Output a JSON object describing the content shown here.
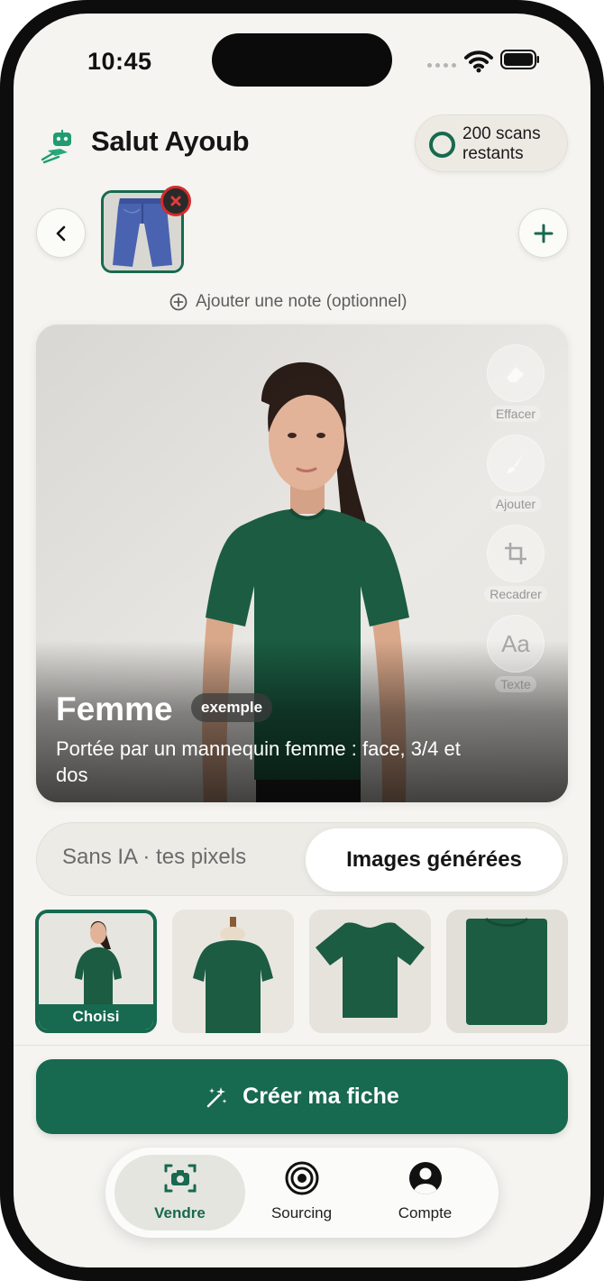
{
  "status_bar": {
    "time": "10:45"
  },
  "header": {
    "greeting": "Salut Ayoub",
    "scans_line1": "200 scans",
    "scans_line2": "restants"
  },
  "uploads": {
    "note_label": "Ajouter une note (optionnel)"
  },
  "hero": {
    "title": "Femme",
    "badge": "exemple",
    "description": "Portée par un mannequin femme : face, 3/4 et dos",
    "tools": [
      "Effacer",
      "Ajouter",
      "Recadrer",
      "Texte"
    ],
    "text_tool_glyph": "Aa"
  },
  "mode_toggle": {
    "options": [
      "Sans IA · tes pixels",
      "Images générées"
    ],
    "selected": "Images générées"
  },
  "variants": {
    "selected_label": "Choisi"
  },
  "cta": {
    "label": "Créer ma fiche"
  },
  "tabbar": {
    "tabs": [
      {
        "label": "Vendre",
        "icon": "camera-icon",
        "active": true
      },
      {
        "label": "Sourcing",
        "icon": "target-icon",
        "active": false
      },
      {
        "label": "Compte",
        "icon": "account-icon",
        "active": false
      }
    ]
  },
  "colors": {
    "brand_green": "#17694f",
    "background": "#f5f4f0",
    "tshirt": "#1b5c42",
    "danger": "#d52a2a"
  }
}
